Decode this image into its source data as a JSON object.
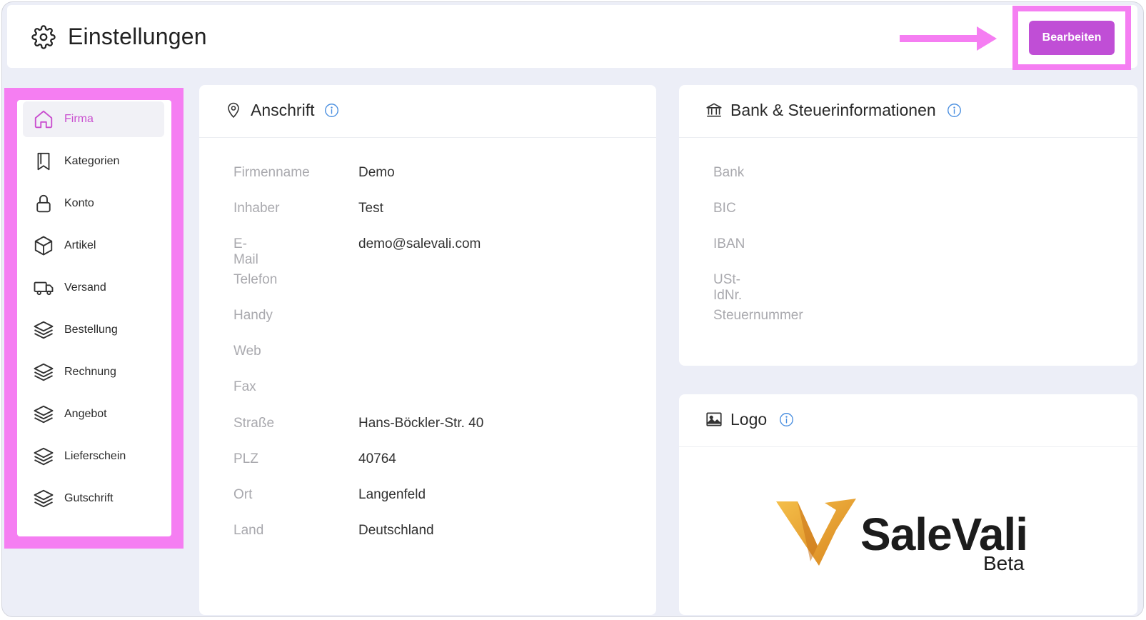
{
  "header": {
    "title": "Einstellungen",
    "edit_label": "Bearbeiten"
  },
  "sidebar": {
    "items": [
      {
        "label": "Firma",
        "icon": "home-icon",
        "active": true
      },
      {
        "label": "Kategorien",
        "icon": "bookmark-icon",
        "active": false
      },
      {
        "label": "Konto",
        "icon": "lock-icon",
        "active": false
      },
      {
        "label": "Artikel",
        "icon": "box-icon",
        "active": false
      },
      {
        "label": "Versand",
        "icon": "truck-icon",
        "active": false
      },
      {
        "label": "Bestellung",
        "icon": "layers-icon",
        "active": false
      },
      {
        "label": "Rechnung",
        "icon": "layers-icon",
        "active": false
      },
      {
        "label": "Angebot",
        "icon": "layers-icon",
        "active": false
      },
      {
        "label": "Lieferschein",
        "icon": "layers-icon",
        "active": false
      },
      {
        "label": "Gutschrift",
        "icon": "layers-icon",
        "active": false
      }
    ]
  },
  "address": {
    "title": "Anschrift",
    "rows": [
      {
        "label": "Firmenname",
        "value": "Demo"
      },
      {
        "label": "Inhaber",
        "value": "Test"
      },
      {
        "label": "E-Mail",
        "value": "demo@salevali.com"
      },
      {
        "label": "Telefon",
        "value": ""
      },
      {
        "label": "Handy",
        "value": ""
      },
      {
        "label": "Web",
        "value": ""
      },
      {
        "label": "Fax",
        "value": ""
      },
      {
        "label": "Straße",
        "value": "Hans-Böckler-Str. 40"
      },
      {
        "label": "PLZ",
        "value": "40764"
      },
      {
        "label": "Ort",
        "value": "Langenfeld"
      },
      {
        "label": "Land",
        "value": "Deutschland"
      }
    ]
  },
  "bank": {
    "title": "Bank & Steuerinformationen",
    "rows": [
      {
        "label": "Bank",
        "value": ""
      },
      {
        "label": "BIC",
        "value": ""
      },
      {
        "label": "IBAN",
        "value": ""
      },
      {
        "label": "USt-IdNr.",
        "value": ""
      },
      {
        "label": "Steuernummer",
        "value": ""
      }
    ]
  },
  "logo": {
    "title": "Logo",
    "brand_name": "SaleVali",
    "brand_tag": "Beta"
  },
  "colors": {
    "accent": "#c04ed6",
    "highlight": "#f57ef2",
    "info": "#4a8fe0",
    "logo_orange": "#e9a43a"
  }
}
